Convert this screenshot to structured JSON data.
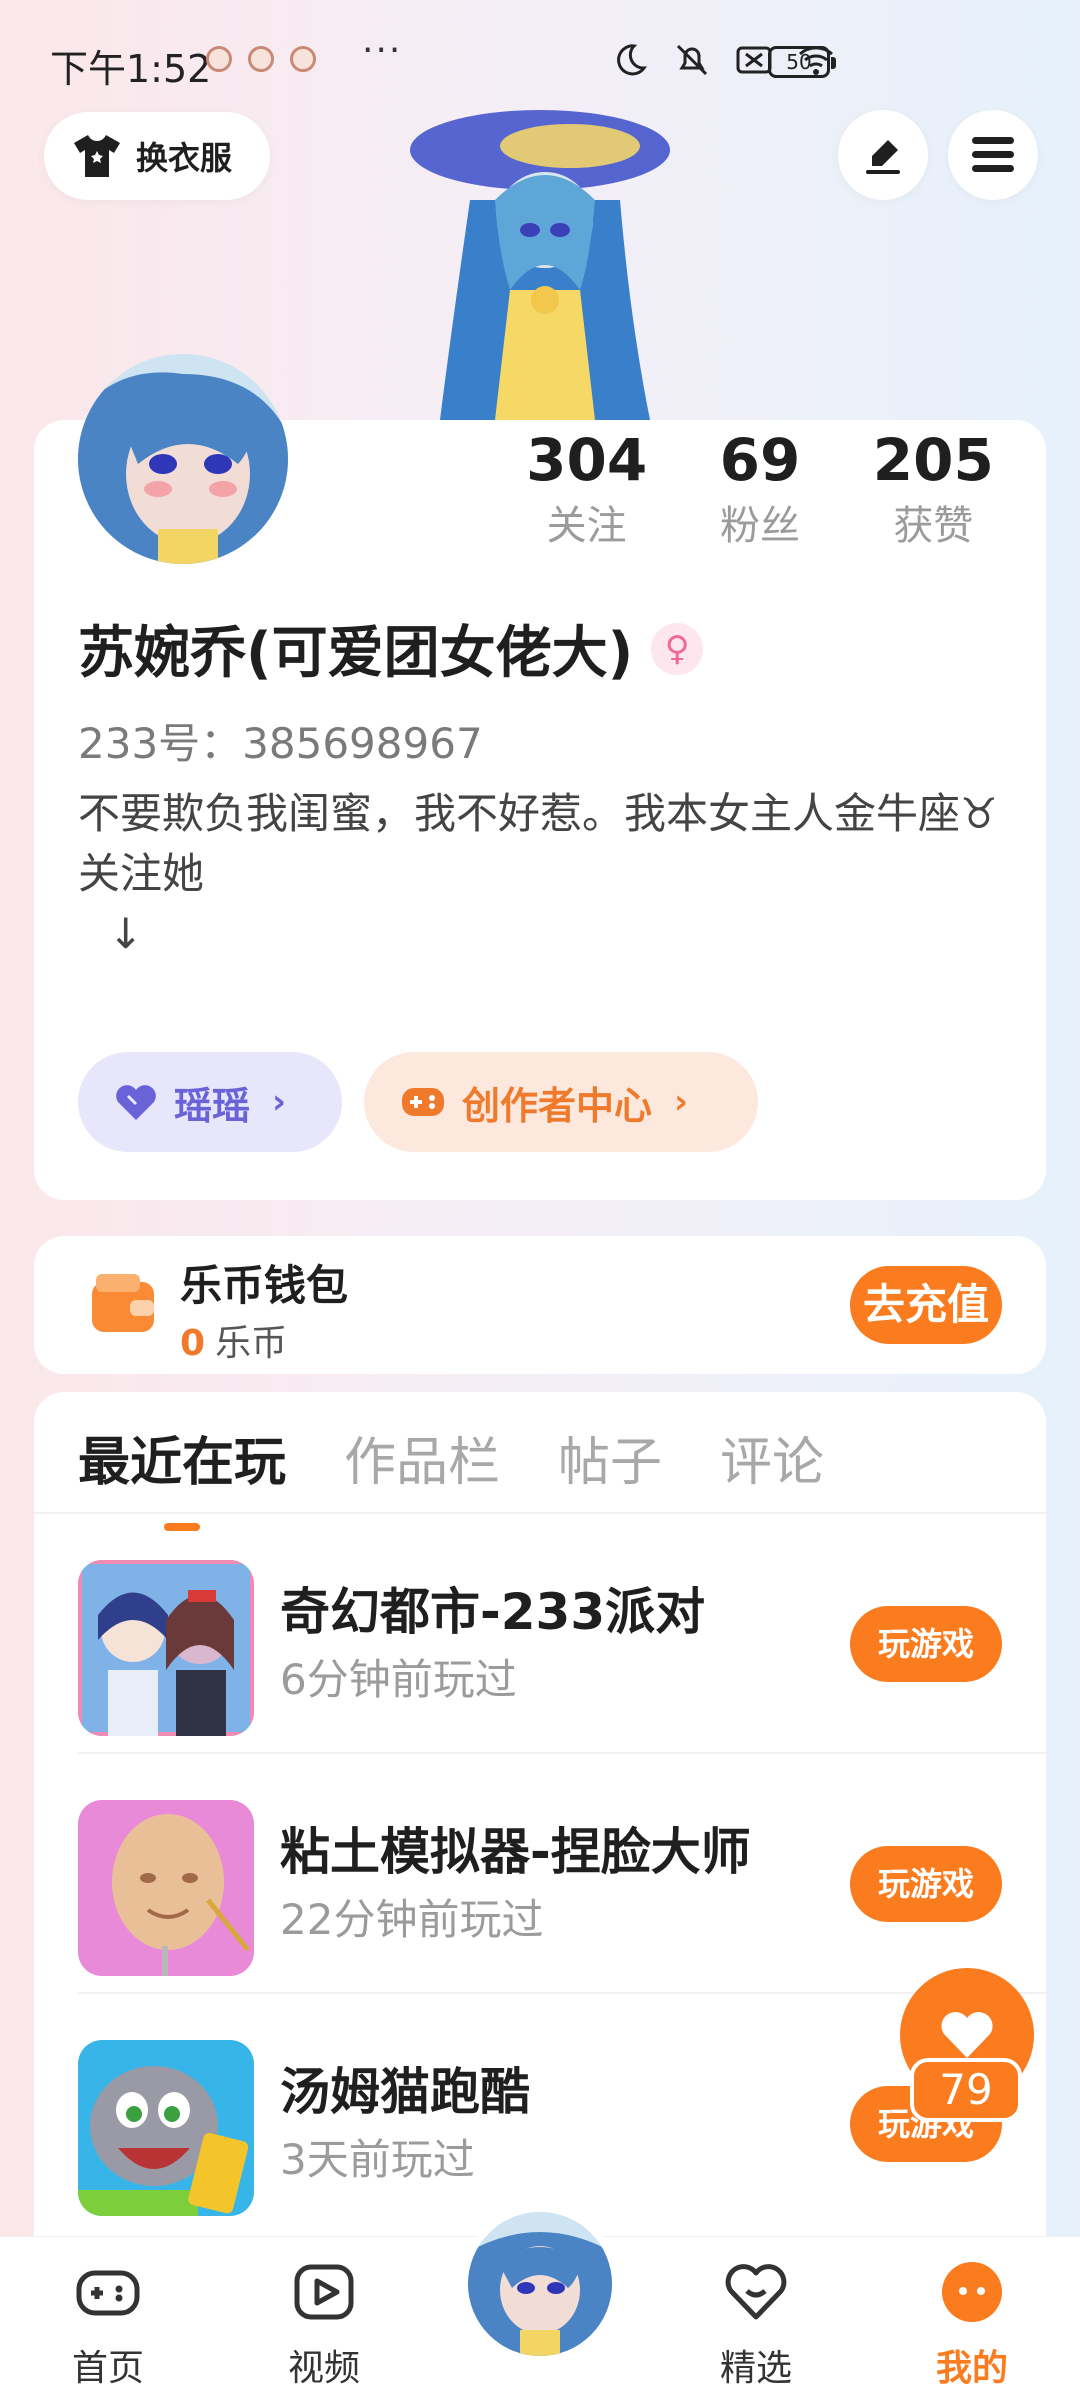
{
  "status_bar": {
    "time": "下午1:52",
    "battery": "50",
    "more": "···"
  },
  "header": {
    "dress_label": "换衣服"
  },
  "profile": {
    "stats": [
      {
        "num": "304",
        "label": "关注"
      },
      {
        "num": "69",
        "label": "粉丝"
      },
      {
        "num": "205",
        "label": "获赞"
      }
    ],
    "name": "苏婉乔(可爱团女佬大)",
    "gender_symbol": "♀",
    "uid": "233号：385698967",
    "bio_line1": "不要欺负我闺蜜，我不好惹。我本女主人金牛座♉",
    "bio_line2": "关注她",
    "bio_line3": "↓",
    "pill_yy": "瑶瑶",
    "pill_cz": "创作者中心",
    "chevron": "›"
  },
  "wallet": {
    "title": "乐币钱包",
    "amount": "0",
    "unit": "乐币",
    "recharge": "去充值"
  },
  "tabs": [
    "最近在玩",
    "作品栏",
    "帖子",
    "评论"
  ],
  "games": [
    {
      "title": "奇幻都市-233派对",
      "sub": "6分钟前玩过",
      "btn": "玩游戏"
    },
    {
      "title": "粘土模拟器-捏脸大师",
      "sub": "22分钟前玩过",
      "btn": "玩游戏"
    },
    {
      "title": "汤姆猫跑酷",
      "sub": "3天前玩过",
      "btn": "玩游戏"
    }
  ],
  "like_count": "79",
  "nav": {
    "home": "首页",
    "video": "视频",
    "featured": "精选",
    "mine": "我的"
  },
  "colors": {
    "accent": "#fa7c1f",
    "purple": "#6a63d8"
  }
}
